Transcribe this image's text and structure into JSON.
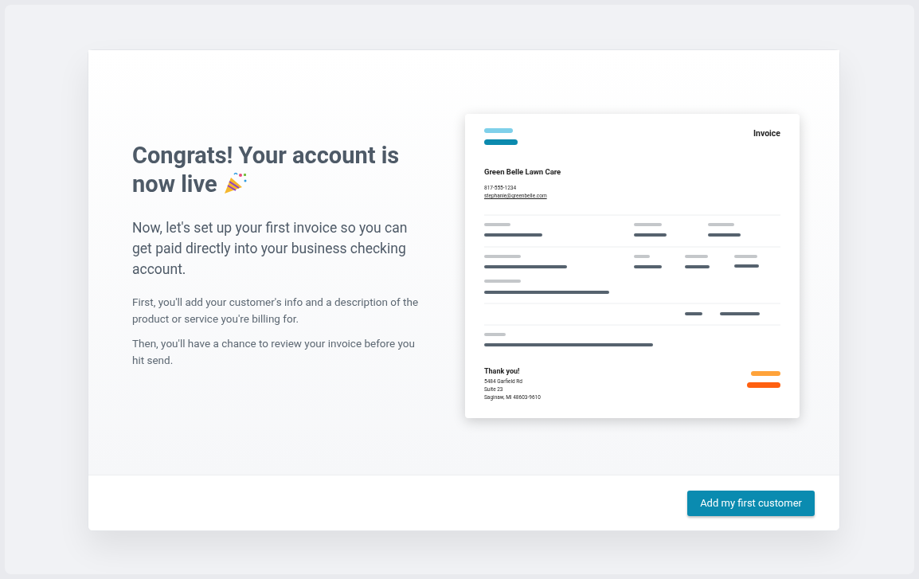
{
  "intro": {
    "heading": "Congrats! Your account is now live",
    "lead": "Now, let's set up your first invoice so you can get paid directly into your business checking account.",
    "paragraphs": [
      "First, you'll add your customer's info and a description of the product or service you're billing for.",
      "Then, you'll have a chance to review your invoice before you hit send."
    ]
  },
  "invoice_preview": {
    "title": "Invoice",
    "business_name": "Green Belle Lawn Care",
    "phone": "817-555-1234",
    "email": "stephanie@greenbelle.com",
    "closing": "Thank you!",
    "address_lines": [
      "5484 Garfield Rd",
      "Suite 23",
      "Saginaw, MI 48603-9610"
    ]
  },
  "footer": {
    "primary_button": "Add my first customer"
  }
}
